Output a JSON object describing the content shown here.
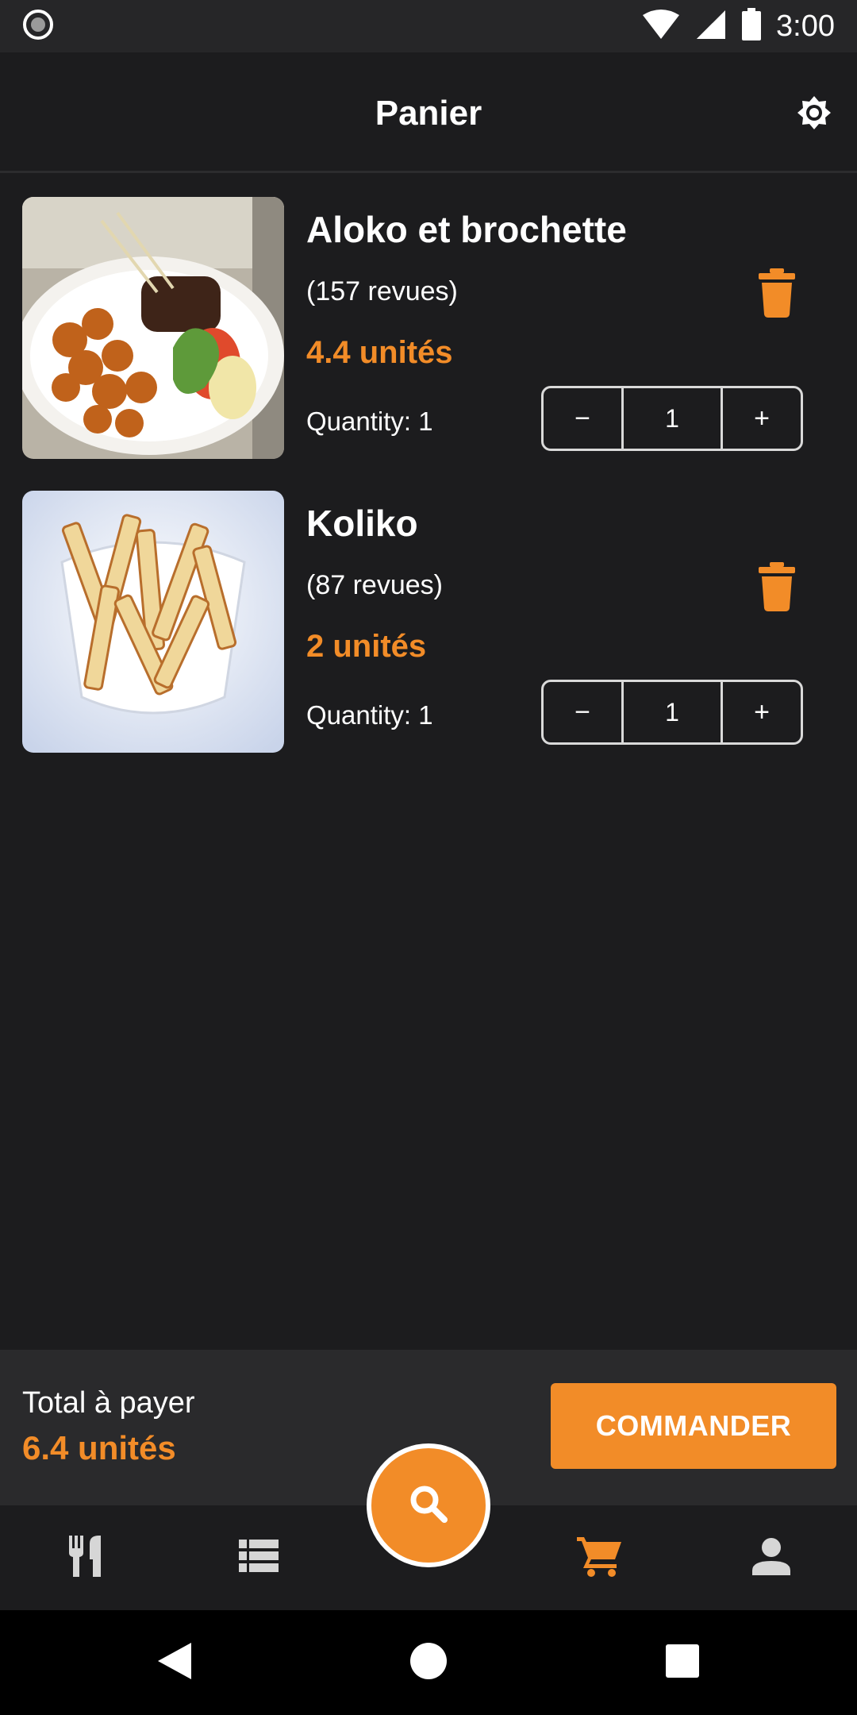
{
  "status_bar": {
    "time": "3:00",
    "icons": [
      "record-icon",
      "wifi-icon",
      "signal-icon",
      "battery-icon"
    ]
  },
  "app_bar": {
    "title": "Panier",
    "theme_icon": "brightness-icon"
  },
  "cart": {
    "items": [
      {
        "name": "Aloko et brochette",
        "reviews": "(157 revues)",
        "price": "4.4 unités",
        "quantity_label": "Quantity: 1",
        "stepper": {
          "minus": "−",
          "value": "1",
          "plus": "+"
        },
        "image": "fried-plantain-and-skewers-photo"
      },
      {
        "name": "Koliko",
        "reviews": "(87 revues)",
        "price": "2 unités",
        "quantity_label": "Quantity: 1",
        "stepper": {
          "minus": "−",
          "value": "1",
          "plus": "+"
        },
        "image": "fried-yam-fries-photo"
      }
    ]
  },
  "total": {
    "label": "Total à payer",
    "value": "6.4 unités",
    "order_button": "COMMANDER"
  },
  "bottom_nav": {
    "items": [
      "restaurant-icon",
      "list-icon",
      "search-icon",
      "cart-icon",
      "profile-icon"
    ],
    "active": "cart-icon"
  },
  "colors": {
    "background": "#1c1c1e",
    "accent": "#f28c28",
    "panel": "#2a2a2c",
    "text": "#ffffff"
  }
}
